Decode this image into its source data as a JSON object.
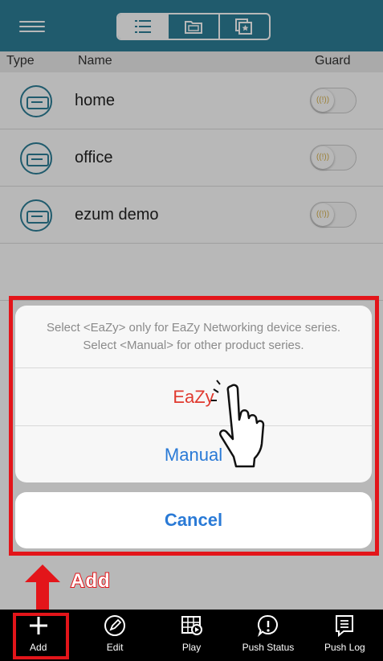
{
  "header": {
    "segments": [
      {
        "icon": "list-icon"
      },
      {
        "icon": "folder-icon"
      },
      {
        "icon": "star-folder-icon"
      }
    ]
  },
  "columns": {
    "type": "Type",
    "name": "Name",
    "guard": "Guard"
  },
  "devices": [
    {
      "name": "home",
      "icon": "dvr-icon"
    },
    {
      "name": "office",
      "icon": "dvr-icon"
    },
    {
      "name": "ezum demo",
      "icon": "dvr-icon"
    }
  ],
  "action_sheet": {
    "message": "Select <EaZy> only for EaZy Networking device series. Select <Manual> for other product series.",
    "option_eazy": "EaZy",
    "option_manual": "Manual",
    "cancel": "Cancel",
    "colors": {
      "eazy": "#e03a2f",
      "manual": "#2a7ad6"
    }
  },
  "annotation": {
    "label": "Add",
    "color": "#e3151a"
  },
  "tabbar": [
    {
      "label": "Add",
      "icon": "plus-icon"
    },
    {
      "label": "Edit",
      "icon": "pencil-icon"
    },
    {
      "label": "Play",
      "icon": "play-icon"
    },
    {
      "label": "Push Status",
      "icon": "alert-icon"
    },
    {
      "label": "Push Log",
      "icon": "log-icon"
    }
  ],
  "colors": {
    "brand": "#2d7f97"
  }
}
